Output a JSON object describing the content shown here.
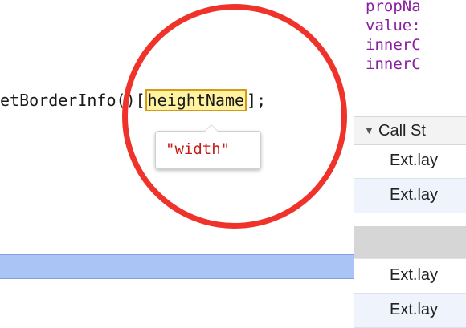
{
  "editor": {
    "code_prefix": "etBorderInfo()[",
    "highlighted_token": "heightName",
    "code_suffix": "];",
    "tooltip_value": "\"width\""
  },
  "scope": {
    "items": [
      "propNa",
      "value:",
      "innerC",
      "innerC"
    ]
  },
  "call_stack": {
    "header": "Call St",
    "frames": [
      "Ext.lay",
      "Ext.lay",
      "",
      "Ext.lay",
      "Ext.lay"
    ]
  },
  "colors": {
    "annotation_ring": "#f0332a",
    "current_line": "#a9c4f5",
    "token_highlight": "#fff3a0",
    "string_value": "#c41a16",
    "scope_keys": "#8a1ea0"
  },
  "icons": {
    "expand_triangle": "triangle-down-icon"
  }
}
